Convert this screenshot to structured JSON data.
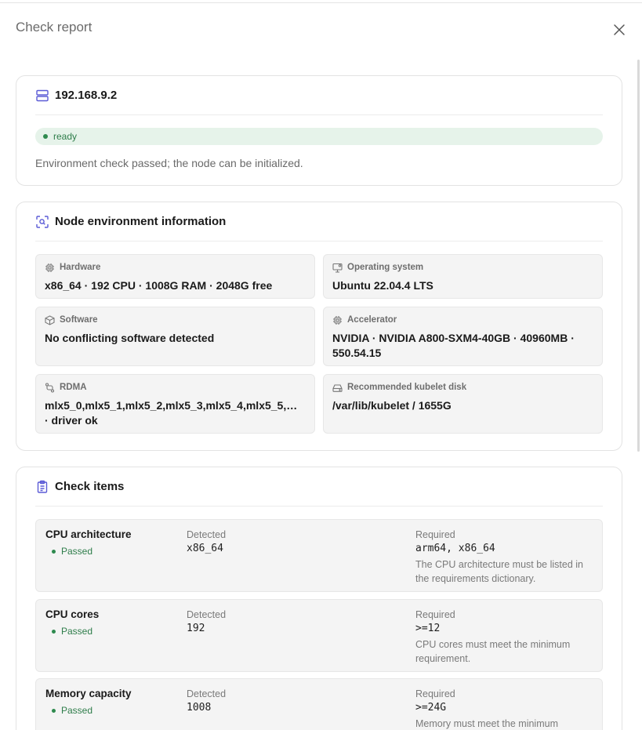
{
  "drawer": {
    "title": "Check report",
    "close_icon": "close-icon"
  },
  "node": {
    "address": "192.168.9.2",
    "icon": "server-icon",
    "status": "ready",
    "message": "Environment check passed; the node can be initialized."
  },
  "environment": {
    "title": "Node environment information",
    "icon": "scan-icon",
    "items": [
      {
        "label": "Hardware",
        "value": "x86_64 · 192 CPU · 1008G RAM · 2048G free",
        "icon": "chip-icon"
      },
      {
        "label": "Operating system",
        "value": "Ubuntu 22.04.4 LTS",
        "icon": "monitor-icon"
      },
      {
        "label": "Software",
        "value": "No conflicting software detected",
        "icon": "package-icon"
      },
      {
        "label": "Accelerator",
        "value": "NVIDIA · NVIDIA A800-SXM4-40GB · 40960MB · 550.54.15",
        "icon": "chip-icon"
      },
      {
        "label": "RDMA",
        "value": "mlx5_0,mlx5_1,mlx5_2,mlx5_3,mlx5_4,mlx5_5,mlx5_…",
        "value2": "· driver ok",
        "icon": "network-icon"
      },
      {
        "label": "Recommended kubelet disk",
        "value": "/var/lib/kubelet / 1655G",
        "icon": "disk-icon"
      }
    ]
  },
  "checks": {
    "title": "Check items",
    "icon": "clipboard-icon",
    "detected_label": "Detected",
    "required_label": "Required",
    "items": [
      {
        "name": "CPU architecture",
        "status": "Passed",
        "detected": "x86_64",
        "required": "arm64, x86_64",
        "description": "The CPU architecture must be listed in the requirements dictionary."
      },
      {
        "name": "CPU cores",
        "status": "Passed",
        "detected": "192",
        "required": ">=12",
        "description": "CPU cores must meet the minimum requirement."
      },
      {
        "name": "Memory capacity",
        "status": "Passed",
        "detected": "1008",
        "required": ">=24G",
        "description": "Memory must meet the minimum requirement."
      }
    ]
  },
  "colors": {
    "accent": "#5b5bd6",
    "success": "#2e8a4e",
    "success_bg": "#e6f3ea",
    "surface": "#f4f4f4"
  }
}
